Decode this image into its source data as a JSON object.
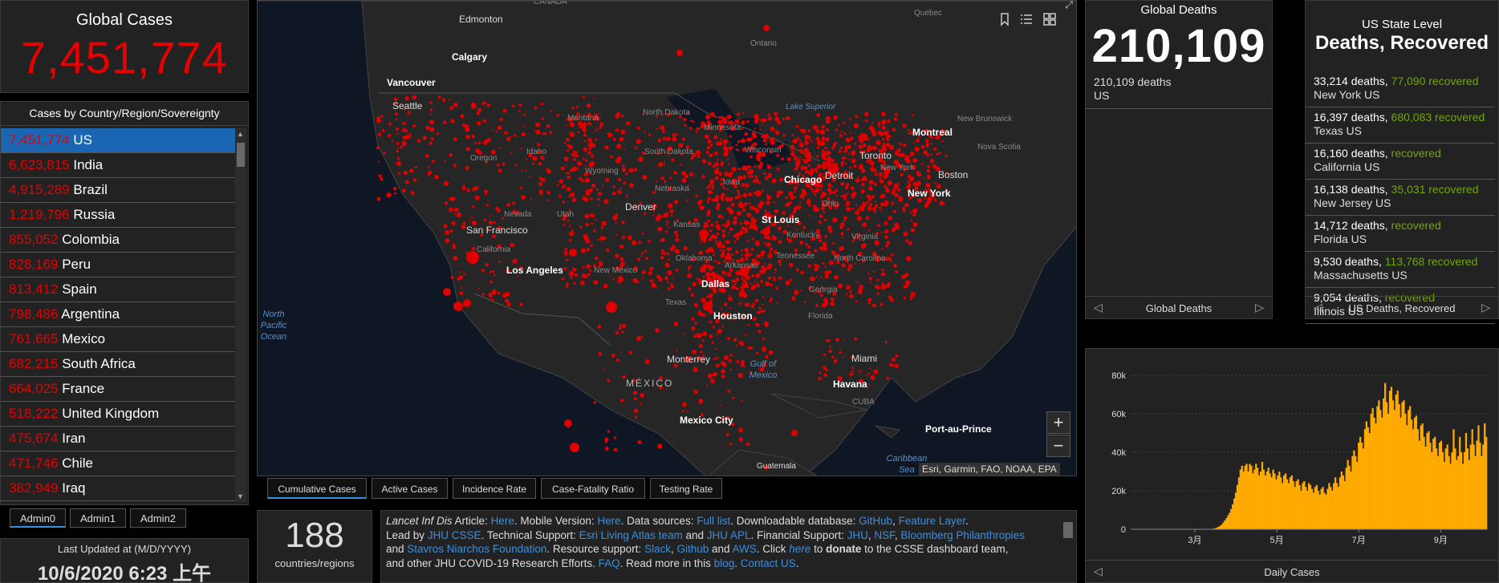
{
  "global_cases": {
    "label": "Global Cases",
    "value": "7,451,774"
  },
  "country_list": {
    "header": "Cases by Country/Region/Sovereignty",
    "rows": [
      {
        "count": "7,451,774",
        "name": "US",
        "selected": true
      },
      {
        "count": "6,623,815",
        "name": "India"
      },
      {
        "count": "4,915,289",
        "name": "Brazil"
      },
      {
        "count": "1,219,796",
        "name": "Russia"
      },
      {
        "count": "855,052",
        "name": "Colombia"
      },
      {
        "count": "828,169",
        "name": "Peru"
      },
      {
        "count": "813,412",
        "name": "Spain"
      },
      {
        "count": "798,486",
        "name": "Argentina"
      },
      {
        "count": "761,665",
        "name": "Mexico"
      },
      {
        "count": "682,215",
        "name": "South Africa"
      },
      {
        "count": "664,025",
        "name": "France"
      },
      {
        "count": "518,222",
        "name": "United Kingdom"
      },
      {
        "count": "475,674",
        "name": "Iran"
      },
      {
        "count": "471,746",
        "name": "Chile"
      },
      {
        "count": "382,949",
        "name": "Iraq"
      }
    ]
  },
  "admin_tabs": [
    "Admin0",
    "Admin1",
    "Admin2"
  ],
  "last_updated": {
    "label": "Last Updated at (M/D/YYYY)",
    "value": "10/6/2020 6:23 上午"
  },
  "map": {
    "labels": {
      "canada": "CANADA",
      "edmonton": "Edmonton",
      "calgary": "Calgary",
      "vancouver": "Vancouver",
      "seattle": "Seattle",
      "quebec": "Quebec",
      "ontario": "Ontario",
      "montreal": "Montreal",
      "toronto": "Toronto",
      "new_brunswick": "New Brunswick",
      "nova_scotia": "Nova Scotia",
      "boston": "Boston",
      "new_york_st": "New York",
      "new_york": "New York",
      "chicago": "Chicago",
      "detroit": "Detroit",
      "denver": "Denver",
      "st_louis": "St Louis",
      "san_francisco": "San Francisco",
      "los_angeles": "Los Angeles",
      "dallas": "Dallas",
      "houston": "Houston",
      "miami": "Miami",
      "monterrey": "Monterrey",
      "mexico_city": "Mexico City",
      "havana": "Havana",
      "cuba": "CUBA",
      "port_au_prince": "Port-au-Prince",
      "guatemala": "Guatemala",
      "mexico": "MÉXICO",
      "lake_superior": "Lake Superior",
      "montana": "Montana",
      "north_dakota": "North Dakota",
      "south_dakota": "South Dakota",
      "minnesota": "Minnesota",
      "wisconsin": "Wisconsin",
      "oregon": "Oregon",
      "idaho": "Idaho",
      "wyoming": "Wyoming",
      "nebraska": "Nebraska",
      "iowa": "Iowa",
      "ohio": "Ohio",
      "nevada": "Nevada",
      "utah": "Utah",
      "california": "California",
      "kansas": "Kansas",
      "kentucky": "Kentucky",
      "virginia": "Virginia",
      "oklahoma": "Oklahoma",
      "arkansas": "Arkansas",
      "tennessee": "Tennessee",
      "north_carolina": "North Carolina",
      "new_mexico": "New Mexico",
      "texas": "Texas",
      "georgia": "Georgia",
      "florida": "Florida",
      "pacific": "North\nPacific\nOcean",
      "gulf": "Gulf of\nMexico",
      "caribbean": "Caribbean\nSea"
    },
    "attribution": "Esri, Garmin, FAO, NOAA, EPA",
    "zoom_in": "+",
    "zoom_out": "−"
  },
  "map_tabs": [
    "Cumulative Cases",
    "Active Cases",
    "Incidence Rate",
    "Case-Fatality Ratio",
    "Testing Rate"
  ],
  "countries_count": {
    "value": "188",
    "label": "countries/regions"
  },
  "global_deaths": {
    "label": "Global Deaths",
    "value": "210,109",
    "item_value": "210,109 deaths",
    "item_region": "US",
    "footer": "Global Deaths"
  },
  "us_state": {
    "label": "US State Level",
    "title": "Deaths, Recovered",
    "rows": [
      {
        "deaths": "33,214 deaths,",
        "recovered": "77,090 recovered",
        "name": "New York US"
      },
      {
        "deaths": "16,397 deaths,",
        "recovered": "680,083 recovered",
        "name": "Texas US"
      },
      {
        "deaths": "16,160 deaths,",
        "recovered": " recovered",
        "name": "California US"
      },
      {
        "deaths": "16,138 deaths,",
        "recovered": "35,031 recovered",
        "name": "New Jersey US"
      },
      {
        "deaths": "14,712 deaths,",
        "recovered": " recovered",
        "name": "Florida US"
      },
      {
        "deaths": "9,530 deaths,",
        "recovered": "113,768 recovered",
        "name": "Massachusetts US"
      },
      {
        "deaths": "9,054 deaths,",
        "recovered": " recovered",
        "name": "Illinois US"
      }
    ],
    "footer": "US Deaths, Recovered"
  },
  "daily_chart_footer": "Daily Cases",
  "chart_data": {
    "type": "bar",
    "title": "Daily Cases",
    "y_ticks": [
      "0",
      "20k",
      "40k",
      "60k",
      "80k"
    ],
    "ylim": [
      0,
      80000
    ],
    "x_ticks": [
      "3月",
      "5月",
      "7月",
      "9月"
    ],
    "color": "#ffaa00",
    "series": [
      {
        "values": [
          0,
          0,
          0,
          0,
          0,
          0,
          0,
          0,
          0,
          0,
          0,
          0,
          0,
          0,
          0,
          0,
          0,
          0,
          0,
          0,
          0,
          0,
          0,
          0,
          0,
          0,
          0,
          0,
          0,
          0,
          0,
          0,
          0,
          0,
          0,
          0,
          0,
          0,
          0,
          0,
          0,
          0,
          0,
          0,
          0,
          0,
          0,
          0,
          0,
          0,
          0,
          100,
          200,
          400,
          600,
          900,
          1300,
          1800,
          2500,
          3500,
          4600,
          5800,
          7200,
          8500,
          10500,
          13000,
          16000,
          19000,
          23000,
          27000,
          31000,
          33000,
          30000,
          33000,
          34000,
          30000,
          34000,
          33000,
          29000,
          31000,
          34000,
          32000,
          28000,
          30000,
          35000,
          31000,
          28000,
          30000,
          32000,
          29000,
          27000,
          31000,
          29000,
          26000,
          28000,
          30000,
          27000,
          24000,
          28000,
          29000,
          26000,
          24000,
          27000,
          28000,
          25000,
          22000,
          25000,
          26000,
          23000,
          20000,
          24000,
          25000,
          22000,
          20000,
          24000,
          23000,
          21000,
          19000,
          22000,
          23000,
          20000,
          18000,
          21000,
          22000,
          19000,
          18000,
          21000,
          24000,
          22000,
          20000,
          24000,
          27000,
          24000,
          22000,
          27000,
          30000,
          28000,
          25000,
          32000,
          36000,
          33000,
          30000,
          38000,
          41000,
          38000,
          35000,
          45000,
          48000,
          45000,
          42000,
          52000,
          56000,
          53000,
          50000,
          60000,
          63000,
          58000,
          55000,
          64000,
          67000,
          62000,
          58000,
          68000,
          76000,
          66000,
          60000,
          72000,
          74000,
          67000,
          62000,
          70000,
          72000,
          65000,
          58000,
          66000,
          67000,
          60000,
          54000,
          62000,
          64000,
          57000,
          52000,
          58000,
          59000,
          52000,
          46000,
          54000,
          55000,
          48000,
          43000,
          50000,
          51000,
          45000,
          40000,
          47000,
          48000,
          42000,
          38000,
          45000,
          46000,
          40000,
          35000,
          42000,
          44000,
          38000,
          34000,
          40000,
          52000,
          42000,
          36000,
          38000,
          48000,
          40000,
          34000,
          40000,
          50000,
          42000,
          36000,
          44000,
          52000,
          44000,
          38000,
          46000,
          54000,
          45000,
          38000,
          44000,
          55000,
          48000
        ]
      }
    ]
  }
}
